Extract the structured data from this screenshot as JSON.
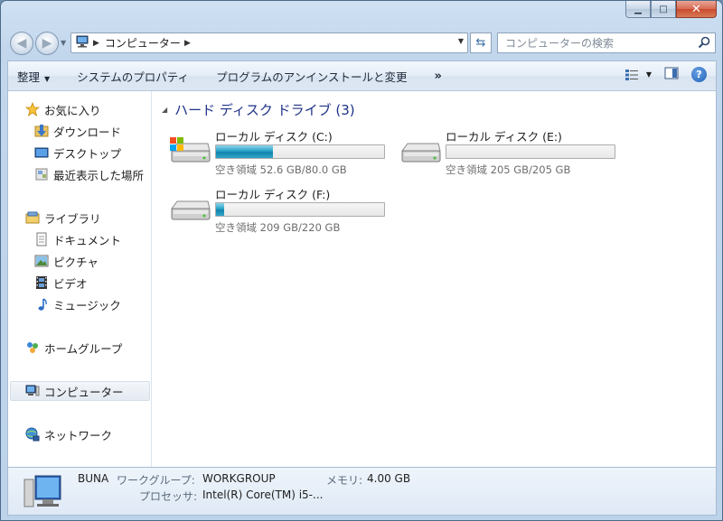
{
  "address": {
    "crumbs": [
      "コンピューター"
    ],
    "search_placeholder": "コンピューターの検索"
  },
  "toolbar": {
    "organize": "整理",
    "system_properties": "システムのプロパティ",
    "uninstall": "プログラムのアンインストールと変更",
    "more": "»"
  },
  "nav": {
    "favorites": "お気に入り",
    "downloads": "ダウンロード",
    "desktop": "デスクトップ",
    "recent": "最近表示した場所",
    "libraries": "ライブラリ",
    "documents": "ドキュメント",
    "pictures": "ピクチャ",
    "videos": "ビデオ",
    "music": "ミュージック",
    "homegroup": "ホームグループ",
    "computer": "コンピューター",
    "network": "ネットワーク"
  },
  "group": {
    "title": "ハード ディスク ドライブ (3)"
  },
  "drives": [
    {
      "name": "ローカル ディスク (C:)",
      "free": "空き領域 52.6 GB/80.0 GB",
      "used_fraction": 0.34,
      "system": true
    },
    {
      "name": "ローカル ディスク (E:)",
      "free": "空き領域 205 GB/205 GB",
      "used_fraction": 0.0,
      "system": false
    },
    {
      "name": "ローカル ディスク (F:)",
      "free": "空き領域 209 GB/220 GB",
      "used_fraction": 0.05,
      "system": false
    }
  ],
  "details": {
    "name": "BUNA",
    "workgroup_label": "ワークグループ:",
    "workgroup": "WORKGROUP",
    "memory_label": "メモリ:",
    "memory": "4.00 GB",
    "processor_label": "プロセッサ:",
    "processor": "Intel(R) Core(TM) i5-..."
  }
}
